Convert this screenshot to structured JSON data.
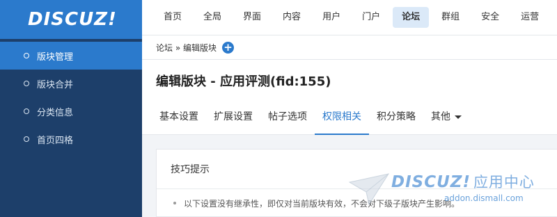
{
  "app": {
    "logo_text": "DISCUZ!"
  },
  "sidebar": {
    "items": [
      {
        "label": "版块管理"
      },
      {
        "label": "版块合并"
      },
      {
        "label": "分类信息"
      },
      {
        "label": "首页四格"
      }
    ],
    "active_index": 0
  },
  "topnav": {
    "items": [
      {
        "label": "首页"
      },
      {
        "label": "全局"
      },
      {
        "label": "界面"
      },
      {
        "label": "内容"
      },
      {
        "label": "用户"
      },
      {
        "label": "门户"
      },
      {
        "label": "论坛"
      },
      {
        "label": "群组"
      },
      {
        "label": "安全"
      },
      {
        "label": "运营"
      }
    ],
    "active_index": 6
  },
  "breadcrumb": {
    "text": "论坛 » 编辑版块",
    "add_icon": "plus-icon"
  },
  "page": {
    "title": "编辑版块 - 应用评测(fid:155)"
  },
  "tabs": {
    "items": [
      {
        "label": "基本设置"
      },
      {
        "label": "扩展设置"
      },
      {
        "label": "帖子选项"
      },
      {
        "label": "权限相关"
      },
      {
        "label": "积分策略"
      },
      {
        "label": "其他"
      }
    ],
    "active_index": 3
  },
  "tips": {
    "heading": "技巧提示",
    "items": [
      "以下设置没有继承性，即仅对当前版块有效，不会对下级子版块产生影响。"
    ]
  },
  "watermark": {
    "logo": "DISCUZ!",
    "tagline": "应用中心",
    "url": "addon.dismall.com"
  },
  "colors": {
    "accent": "#2b7acc",
    "sidebar_bg": "#1d3f6a"
  }
}
